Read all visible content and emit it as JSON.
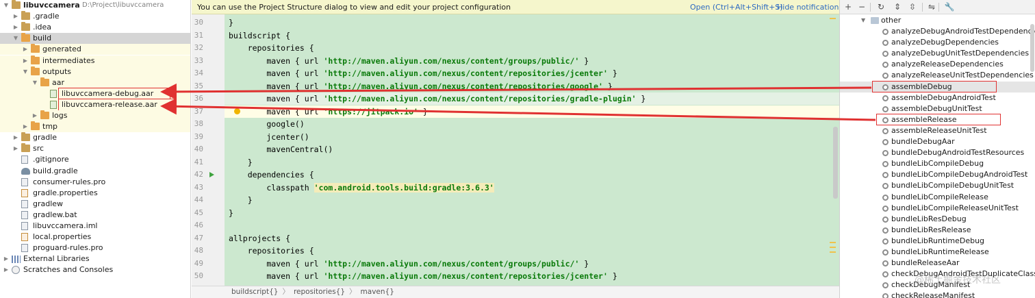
{
  "project_tree": [
    {
      "label": "libuvccamera",
      "path": "D:\\Project\\libuvccamera",
      "depth": 0,
      "icon": "module-folder-icon",
      "arrow": "▼",
      "state": "normal"
    },
    {
      "label": ".gradle",
      "depth": 1,
      "icon": "folder-icon",
      "arrow": "▶",
      "state": "normal"
    },
    {
      "label": ".idea",
      "depth": 1,
      "icon": "folder-icon",
      "arrow": "▶",
      "state": "normal"
    },
    {
      "label": "build",
      "depth": 1,
      "icon": "folder-orange-icon",
      "arrow": "▼",
      "state": "selected"
    },
    {
      "label": "generated",
      "depth": 2,
      "icon": "folder-orange-icon",
      "arrow": "▶",
      "state": "band"
    },
    {
      "label": "intermediates",
      "depth": 2,
      "icon": "folder-orange-icon",
      "arrow": "▶",
      "state": "band"
    },
    {
      "label": "outputs",
      "depth": 2,
      "icon": "folder-orange-icon",
      "arrow": "▼",
      "state": "band"
    },
    {
      "label": "aar",
      "depth": 3,
      "icon": "folder-orange-icon",
      "arrow": "▼",
      "state": "band"
    },
    {
      "label": "libuvccamera-debug.aar",
      "depth": 4,
      "icon": "aar-file-icon",
      "arrow": "",
      "state": "band",
      "boxed": true
    },
    {
      "label": "libuvccamera-release.aar",
      "depth": 4,
      "icon": "aar-file-icon",
      "arrow": "",
      "state": "band",
      "boxed": true
    },
    {
      "label": "logs",
      "depth": 3,
      "icon": "folder-orange-icon",
      "arrow": "▶",
      "state": "band"
    },
    {
      "label": "tmp",
      "depth": 2,
      "icon": "folder-orange-icon",
      "arrow": "▶",
      "state": "band"
    },
    {
      "label": "gradle",
      "depth": 1,
      "icon": "folder-icon",
      "arrow": "▶",
      "state": "normal"
    },
    {
      "label": "src",
      "depth": 1,
      "icon": "folder-icon",
      "arrow": "▶",
      "state": "normal"
    },
    {
      "label": ".gitignore",
      "depth": 1,
      "icon": "file-icon",
      "arrow": "",
      "state": "normal"
    },
    {
      "label": "build.gradle",
      "depth": 1,
      "icon": "gradle-file-icon",
      "arrow": "",
      "state": "normal"
    },
    {
      "label": "consumer-rules.pro",
      "depth": 1,
      "icon": "file-icon",
      "arrow": "",
      "state": "normal"
    },
    {
      "label": "gradle.properties",
      "depth": 1,
      "icon": "xml-file-icon",
      "arrow": "",
      "state": "normal"
    },
    {
      "label": "gradlew",
      "depth": 1,
      "icon": "file-icon",
      "arrow": "",
      "state": "normal"
    },
    {
      "label": "gradlew.bat",
      "depth": 1,
      "icon": "file-icon",
      "arrow": "",
      "state": "normal"
    },
    {
      "label": "libuvccamera.iml",
      "depth": 1,
      "icon": "file-icon",
      "arrow": "",
      "state": "normal"
    },
    {
      "label": "local.properties",
      "depth": 1,
      "icon": "xml-file-icon",
      "arrow": "",
      "state": "normal"
    },
    {
      "label": "proguard-rules.pro",
      "depth": 1,
      "icon": "file-icon",
      "arrow": "",
      "state": "normal"
    },
    {
      "label": "External Libraries",
      "depth": 0,
      "icon": "library-icon",
      "arrow": "▶",
      "state": "normal"
    },
    {
      "label": "Scratches and Consoles",
      "depth": 0,
      "icon": "scratch-icon",
      "arrow": "▶",
      "state": "normal"
    }
  ],
  "notification": {
    "message": "You can use the Project Structure dialog to view and edit your project configuration",
    "open_link": "Open (Ctrl+Alt+Shift+S)",
    "hide_link": "Hide notification",
    "color": "#f5f6cc"
  },
  "editor": {
    "background": "#cce8cf",
    "lines": [
      {
        "num": "30",
        "text": "}",
        "str": "",
        "tail": ""
      },
      {
        "num": "31",
        "text": "buildscript {",
        "str": "",
        "tail": ""
      },
      {
        "num": "32",
        "text": "    repositories {",
        "str": "",
        "tail": ""
      },
      {
        "num": "33",
        "text": "        maven { url ",
        "str": "'http://maven.aliyun.com/nexus/content/groups/public/'",
        "tail": " }"
      },
      {
        "num": "34",
        "text": "        maven { url ",
        "str": "'http://maven.aliyun.com/nexus/content/repositories/jcenter'",
        "tail": " }"
      },
      {
        "num": "35",
        "text": "        maven { url ",
        "str": "'http://maven.aliyun.com/nexus/content/repositories/google'",
        "tail": " }"
      },
      {
        "num": "36",
        "text": "        maven { url ",
        "str": "'http://maven.aliyun.com/nexus/content/repositories/gradle-plugin'",
        "tail": " }"
      },
      {
        "num": "37",
        "text": "        maven { url ",
        "str": "'https://jitpack.io'",
        "tail": " }"
      },
      {
        "num": "38",
        "text": "        google()",
        "str": "",
        "tail": ""
      },
      {
        "num": "39",
        "text": "        jcenter()",
        "str": "",
        "tail": ""
      },
      {
        "num": "40",
        "text": "        mavenCentral()",
        "str": "",
        "tail": ""
      },
      {
        "num": "41",
        "text": "    }",
        "str": "",
        "tail": ""
      },
      {
        "num": "42",
        "text": "    dependencies {",
        "str": "",
        "tail": ""
      },
      {
        "num": "43",
        "text": "        classpath ",
        "str": "'com.android.tools.build:gradle:3.6.3'",
        "tail": ""
      },
      {
        "num": "44",
        "text": "    }",
        "str": "",
        "tail": ""
      },
      {
        "num": "45",
        "text": "}",
        "str": "",
        "tail": ""
      },
      {
        "num": "46",
        "text": "",
        "str": "",
        "tail": ""
      },
      {
        "num": "47",
        "text": "allprojects {",
        "str": "",
        "tail": ""
      },
      {
        "num": "48",
        "text": "    repositories {",
        "str": "",
        "tail": ""
      },
      {
        "num": "49",
        "text": "        maven { url ",
        "str": "'http://maven.aliyun.com/nexus/content/groups/public/'",
        "tail": " }"
      },
      {
        "num": "50",
        "text": "        maven { url ",
        "str": "'http://maven.aliyun.com/nexus/content/repositories/jcenter'",
        "tail": " }"
      }
    ],
    "current_line": "37",
    "run_marker_line": "42",
    "breadcrumbs": [
      "buildscript{}",
      "repositories{}",
      "maven{}"
    ],
    "breadcrumb_separator": "〉"
  },
  "gradle_panel": {
    "toolbar": [
      "add-icon",
      "remove-icon",
      "refresh-icon",
      "expand-all-icon",
      "collapse-all-icon",
      "toggle-offline-icon",
      "wrench-icon"
    ],
    "group_label": "other",
    "tasks": [
      {
        "label": "analyzeDebugAndroidTestDependencies"
      },
      {
        "label": "analyzeDebugDependencies"
      },
      {
        "label": "analyzeDebugUnitTestDependencies"
      },
      {
        "label": "analyzeReleaseDependencies"
      },
      {
        "label": "analyzeReleaseUnitTestDependencies"
      },
      {
        "label": "assembleDebug",
        "selected": true,
        "boxed": true
      },
      {
        "label": "assembleDebugAndroidTest"
      },
      {
        "label": "assembleDebugUnitTest"
      },
      {
        "label": "assembleRelease",
        "boxed": true
      },
      {
        "label": "assembleReleaseUnitTest"
      },
      {
        "label": "bundleDebugAar"
      },
      {
        "label": "bundleDebugAndroidTestResources"
      },
      {
        "label": "bundleLibCompileDebug"
      },
      {
        "label": "bundleLibCompileDebugAndroidTest"
      },
      {
        "label": "bundleLibCompileDebugUnitTest"
      },
      {
        "label": "bundleLibCompileRelease"
      },
      {
        "label": "bundleLibCompileReleaseUnitTest"
      },
      {
        "label": "bundleLibResDebug"
      },
      {
        "label": "bundleLibResRelease"
      },
      {
        "label": "bundleLibRuntimeDebug"
      },
      {
        "label": "bundleLibRuntimeRelease"
      },
      {
        "label": "bundleReleaseAar"
      },
      {
        "label": "checkDebugAndroidTestDuplicateClasses"
      },
      {
        "label": "checkDebugManifest"
      },
      {
        "label": "checkReleaseManifest"
      }
    ]
  },
  "watermark": "@稀土掘金技术社区",
  "colors": {
    "annotation_red": "#e03131",
    "selection": "#d5d5d5",
    "build_band": "#fdfbe3",
    "string_green": "#0a7a0a",
    "link_blue": "#2d6ac1"
  }
}
